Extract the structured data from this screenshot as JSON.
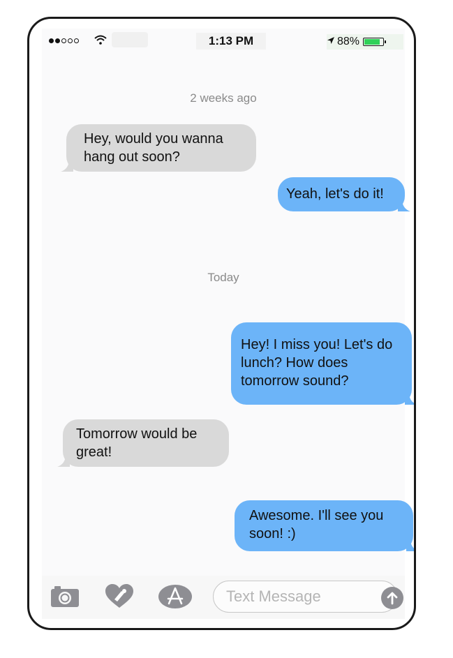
{
  "status_bar": {
    "time": "1:13 PM",
    "battery_percent": "88%",
    "signal_bars_filled": 2,
    "signal_bars_total": 5,
    "battery_level": 0.88,
    "battery_color": "#2fd158"
  },
  "timestamps": [
    "2 weeks ago",
    "Today"
  ],
  "messages": [
    {
      "direction": "incoming",
      "lines": [
        "Hey, would you wanna",
        "hang out soon?"
      ]
    },
    {
      "direction": "outgoing",
      "lines": [
        "Yeah, let's do it!"
      ]
    },
    {
      "direction": "outgoing",
      "lines": [
        "Hey! I miss you! Let's do",
        "lunch? How does",
        "tomorrow sound?"
      ]
    },
    {
      "direction": "incoming",
      "lines": [
        "Tomorrow would be",
        "great!"
      ]
    },
    {
      "direction": "outgoing",
      "lines": [
        "Awesome. I'll see you",
        "soon! :)"
      ]
    }
  ],
  "input_bar": {
    "placeholder": "Text Message",
    "icons": [
      "camera-icon",
      "digital-touch-heart-icon",
      "app-store-icon",
      "send-arrow-icon"
    ]
  },
  "colors": {
    "incoming_bubble": "#d9d9d9",
    "outgoing_bubble": "#6cb4f8",
    "timestamp_text": "#8a8a8a",
    "icon_gray": "#8e8e93"
  }
}
